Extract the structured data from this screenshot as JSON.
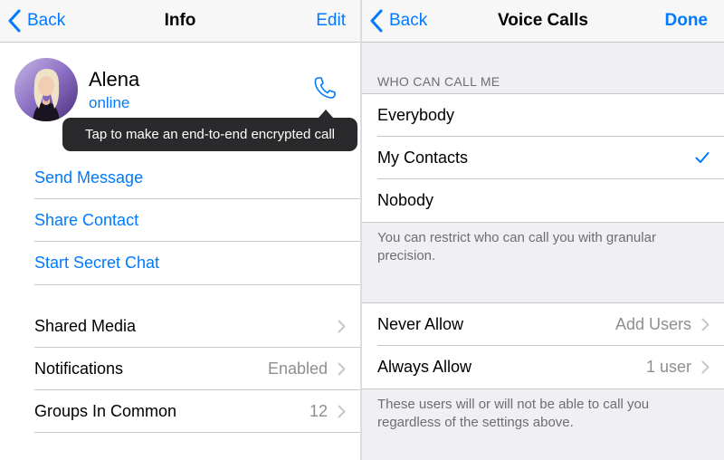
{
  "left": {
    "navbar": {
      "back_label": "Back",
      "title": "Info",
      "edit_label": "Edit"
    },
    "profile": {
      "name": "Alena",
      "status": "online"
    },
    "tooltip": "Tap to make an end-to-end encrypted call",
    "actions": [
      {
        "label": "Send Message"
      },
      {
        "label": "Share Contact"
      },
      {
        "label": "Start Secret Chat"
      }
    ],
    "settings": [
      {
        "label": "Shared Media",
        "value": ""
      },
      {
        "label": "Notifications",
        "value": "Enabled"
      },
      {
        "label": "Groups In Common",
        "value": "12"
      }
    ]
  },
  "right": {
    "navbar": {
      "back_label": "Back",
      "title": "Voice Calls",
      "done_label": "Done"
    },
    "section_header": "WHO CAN CALL ME",
    "options": [
      {
        "label": "Everybody",
        "selected": false
      },
      {
        "label": "My Contacts",
        "selected": true
      },
      {
        "label": "Nobody",
        "selected": false
      }
    ],
    "options_footer": "You can restrict who can call you with granular precision.",
    "exceptions": [
      {
        "label": "Never Allow",
        "value": "Add Users"
      },
      {
        "label": "Always Allow",
        "value": "1 user"
      }
    ],
    "exceptions_footer": "These users will or will not be able to call you regardless of the settings above."
  },
  "colors": {
    "accent": "#007aff",
    "secondary_text": "#8e8e93",
    "grouped_background": "#efeff4",
    "tooltip_background": "#2a2a2c"
  },
  "icons": [
    "chevron-left-icon",
    "phone-icon",
    "chevron-right-icon",
    "checkmark-icon"
  ]
}
